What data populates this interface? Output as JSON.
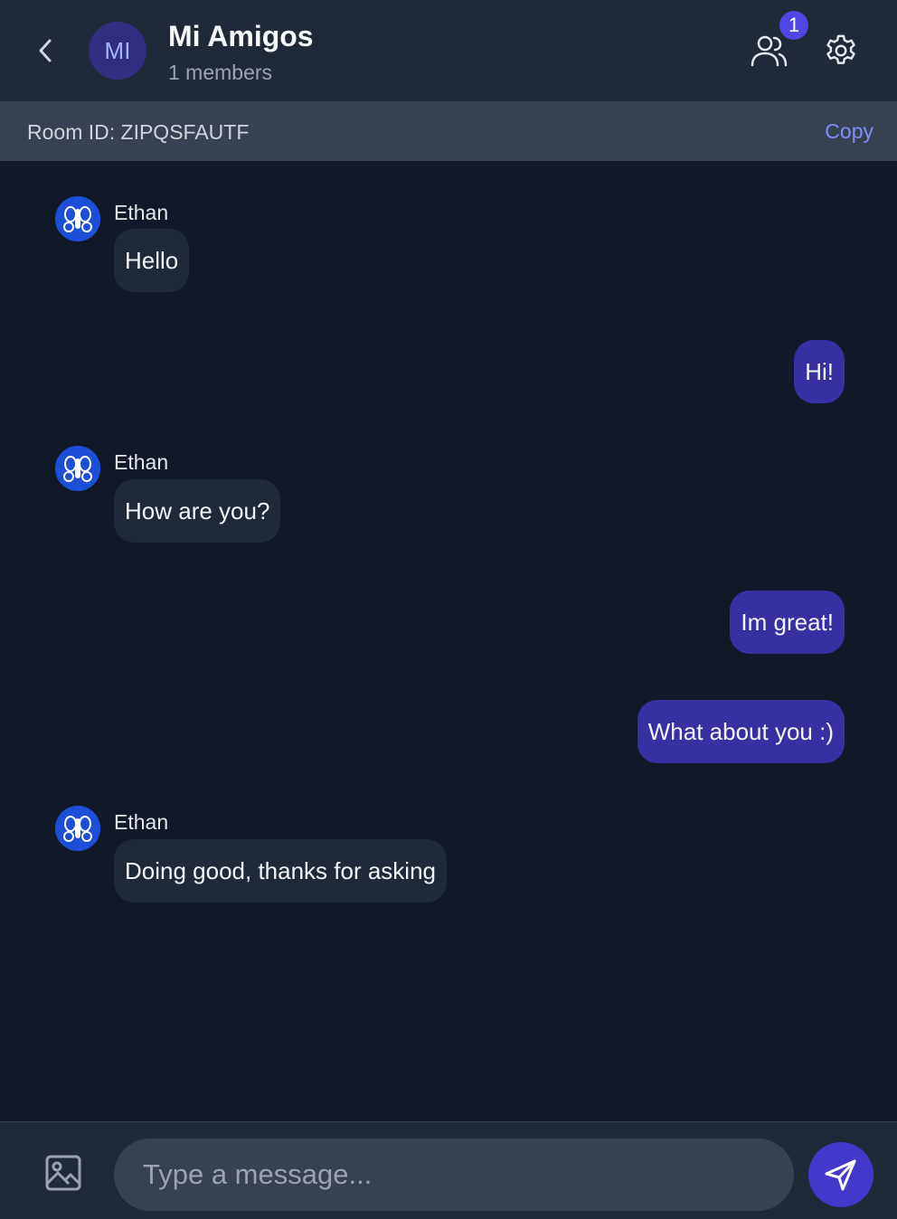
{
  "header": {
    "room_initials": "MI",
    "room_name": "Mi Amigos",
    "member_count_text": "1 members",
    "member_badge": "1"
  },
  "roombar": {
    "room_id_text": "Room ID: ZIPQSFAUTF",
    "copy_label": "Copy"
  },
  "messages": [
    {
      "direction": "incoming",
      "sender": "Ethan",
      "text": "Hello"
    },
    {
      "direction": "outgoing",
      "text": "Hi!"
    },
    {
      "direction": "incoming",
      "sender": "Ethan",
      "text": "How are you?"
    },
    {
      "direction": "outgoing",
      "text": "Im great!"
    },
    {
      "direction": "outgoing",
      "text": "What about you :)"
    },
    {
      "direction": "incoming",
      "sender": "Ethan",
      "text": "Doing good, thanks for asking"
    }
  ],
  "composer": {
    "placeholder": "Type a message..."
  },
  "icons": {
    "back": "chevron-left-icon",
    "members": "users-icon",
    "settings": "gear-icon",
    "image": "image-icon",
    "send": "send-icon"
  },
  "colors": {
    "accent": "#4f46e5",
    "outgoing_bubble": "#3730a3",
    "incoming_bubble": "#1f2937",
    "link": "#818cf8"
  }
}
